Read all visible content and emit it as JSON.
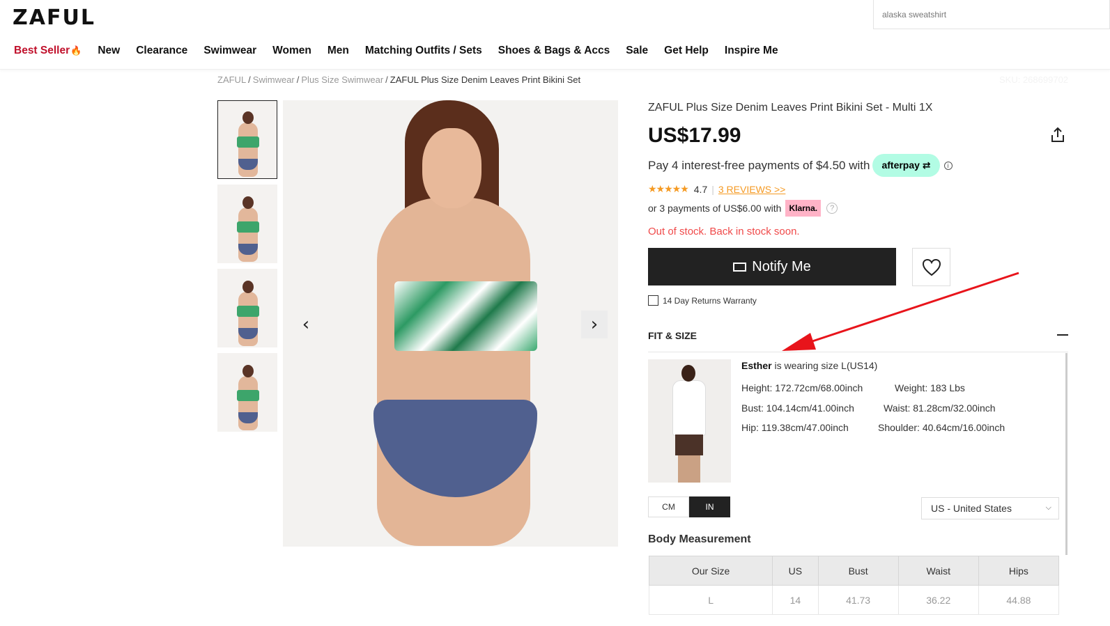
{
  "header": {
    "logo": "ZAFUL",
    "search_placeholder": "alaska sweatshirt",
    "nav": [
      "Best Seller",
      "New",
      "Clearance",
      "Swimwear",
      "Women",
      "Men",
      "Matching Outfits / Sets",
      "Shoes & Bags & Accs",
      "Sale",
      "Get Help",
      "Inspire Me"
    ]
  },
  "breadcrumb": [
    "ZAFUL",
    "Swimwear",
    "Plus Size Swimwear",
    "ZAFUL Plus Size Denim Leaves Print Bikini Set"
  ],
  "sku": "SKU: 268699702",
  "product": {
    "title": "ZAFUL Plus Size Denim Leaves Print Bikini Set - Multi 1X",
    "price": "US$17.99",
    "afterpay_text": "Pay 4 interest-free payments of $4.50 with",
    "afterpay_badge": "afterpay",
    "rating": "4.7",
    "stars": "★★★★★",
    "reviews": "3 REVIEWS >>",
    "klarna_text": "or 3 payments of US$6.00 with",
    "klarna_badge": "Klarna.",
    "stock": "Out of stock. Back in stock soon.",
    "notify": "Notify Me",
    "returns": "14 Day Returns Warranty"
  },
  "fit": {
    "heading": "FIT & SIZE",
    "model_name": "Esther",
    "model_size": " is wearing size L(US14)",
    "height": "Height: 172.72cm/68.00inch",
    "weight": "Weight: 183 Lbs",
    "bust": "Bust: 104.14cm/41.00inch",
    "waist": "Waist: 81.28cm/32.00inch",
    "hip": "Hip: 119.38cm/47.00inch",
    "shoulder": "Shoulder: 40.64cm/16.00inch",
    "unit_cm": "CM",
    "unit_in": "IN",
    "country": "US - United States",
    "body_measurement": "Body Measurement",
    "table_headers": [
      "Our Size",
      "US",
      "Bust",
      "Waist",
      "Hips"
    ],
    "table_rows": [
      [
        "L",
        "14",
        "41.73",
        "36.22",
        "44.88"
      ]
    ]
  },
  "colors": {
    "accent": "#c0102b",
    "alert": "#f04a4a",
    "rating": "#f59a23",
    "afterpay": "#b2fce4",
    "klarna": "#ffb3c7",
    "annotation": "#e8141b"
  }
}
